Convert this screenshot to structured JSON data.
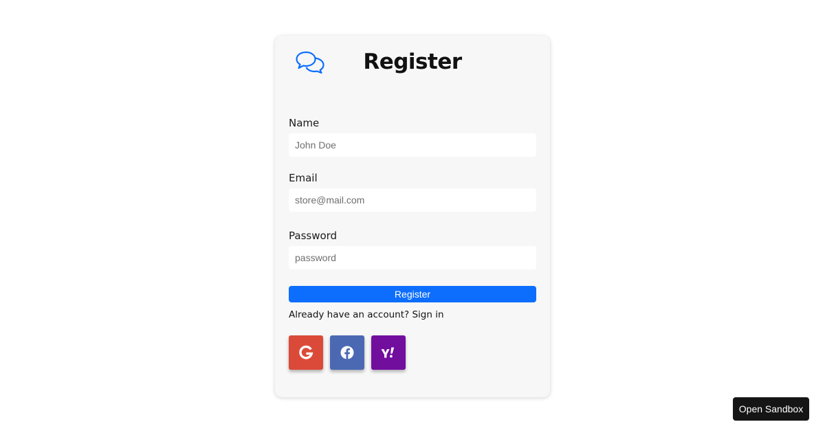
{
  "form": {
    "title": "Register",
    "fields": [
      {
        "label": "Name",
        "placeholder": "John Doe",
        "value": ""
      },
      {
        "label": "Email",
        "placeholder": "store@mail.com",
        "value": ""
      },
      {
        "label": "Password",
        "placeholder": "password",
        "value": ""
      }
    ],
    "submit_label": "Register",
    "signin_prompt": "Already have an account?",
    "signin_link": "Sign in"
  },
  "social": [
    {
      "name": "google",
      "icon": "google-icon",
      "color": "#db4a39"
    },
    {
      "name": "facebook",
      "icon": "facebook-icon",
      "color": "#4b69b3"
    },
    {
      "name": "yahoo",
      "icon": "yahoo-icon",
      "color": "#720e9e"
    }
  ],
  "sandbox": {
    "label": "Open Sandbox"
  },
  "colors": {
    "primary": "#0d6efd",
    "card_background": "#f7f7f7"
  }
}
